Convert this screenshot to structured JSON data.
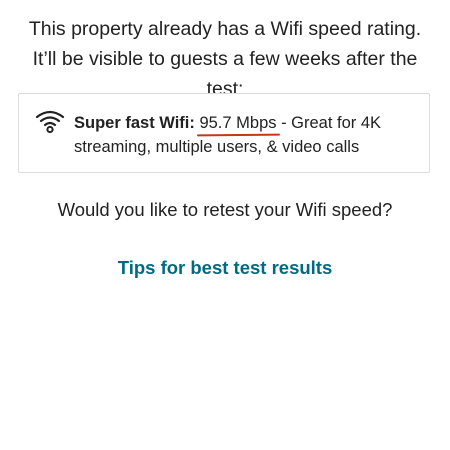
{
  "intro": {
    "text": "This property already has a Wifi speed rating. It’ll be visible to guests a few weeks after the test:"
  },
  "rating": {
    "icon": "wifi-icon",
    "label": "Super fast Wifi:",
    "speed": "95.7 Mbps",
    "description": "- Great for 4K streaming, multiple users, & video calls",
    "underline_color": "#c0391b"
  },
  "retest": {
    "question": "Would you like to retest your Wifi speed?"
  },
  "tips": {
    "link_label": "Tips for best test results",
    "link_color": "#006b80"
  }
}
